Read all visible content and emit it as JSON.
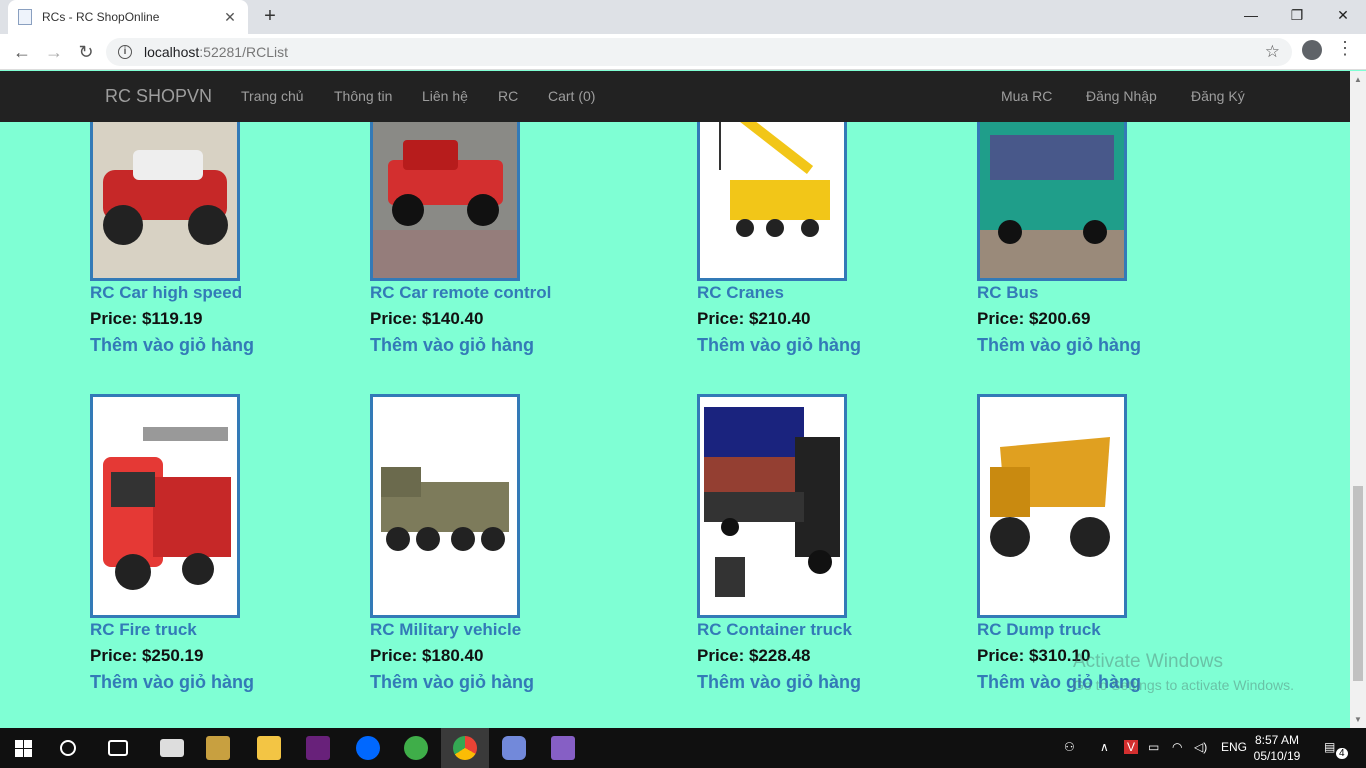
{
  "browser": {
    "tab_title": "RCs - RC ShopOnline",
    "tab_close": "✕",
    "new_tab": "+",
    "url_host": "localhost",
    "url_port_path": ":52281/RCList",
    "min": "—",
    "max": "❐",
    "close": "✕"
  },
  "navbar": {
    "brand": "RC SHOPVN",
    "links": [
      "Trang chủ",
      "Thông tin",
      "Liên hệ",
      "RC",
      "Cart (0)"
    ],
    "right_links": [
      "Mua RC",
      "Đăng Nhập",
      "Đăng Ký"
    ]
  },
  "products": [
    {
      "name": "RC Car high speed",
      "price": "Price: $119.19",
      "add": "Thêm vào giỏ hàng",
      "color": "#c62828"
    },
    {
      "name": "RC Car remote control",
      "price": "Price: $140.40",
      "add": "Thêm vào giỏ hàng",
      "color": "#d32f2f"
    },
    {
      "name": "RC Cranes",
      "price": "Price: $210.40",
      "add": "Thêm vào giỏ hàng",
      "color": "#f2c618"
    },
    {
      "name": "RC Bus",
      "price": "Price: $200.69",
      "add": "Thêm vào giỏ hàng",
      "color": "#1f9e8a"
    },
    {
      "name": "RC Fire truck",
      "price": "Price: $250.19",
      "add": "Thêm vào giỏ hàng",
      "color": "#e53935"
    },
    {
      "name": "RC Military vehicle",
      "price": "Price: $180.40",
      "add": "Thêm vào giỏ hàng",
      "color": "#7d7b5b"
    },
    {
      "name": "RC Container truck",
      "price": "Price: $228.48",
      "add": "Thêm vào giỏ hàng",
      "color": "#222222"
    },
    {
      "name": "RC Dump truck",
      "price": "Price: $310.10",
      "add": "Thêm vào giỏ hàng",
      "color": "#e0a020"
    }
  ],
  "watermark": {
    "title": "Activate Windows",
    "subtitle": "Go to Settings to activate Windows."
  },
  "taskbar": {
    "lang": "ENG",
    "time": "8:57 AM",
    "date": "05/10/19",
    "notif_count": "4"
  },
  "colors": {
    "page_bg": "#7fffd4",
    "link": "#337ab7",
    "navbar": "#222222"
  }
}
